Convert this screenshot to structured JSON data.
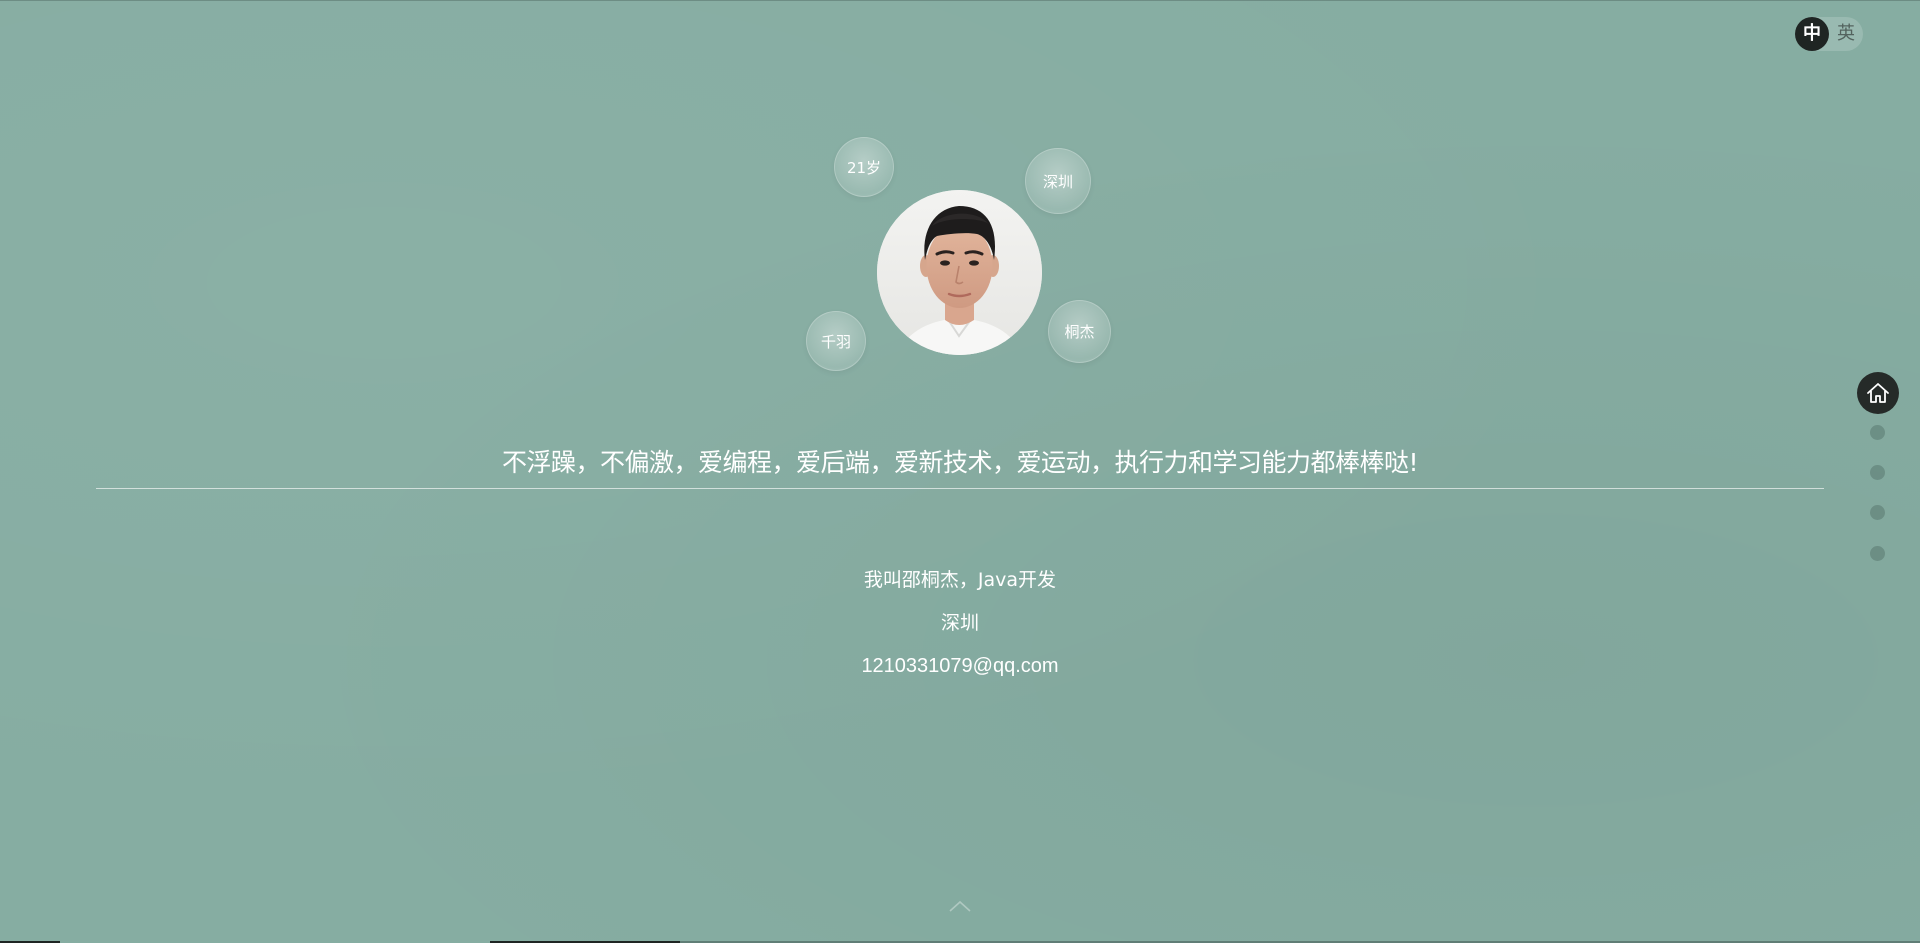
{
  "language_switch": {
    "zh_label": "中",
    "en_label": "英",
    "active": "zh"
  },
  "profile": {
    "avatar_alt": "profile photo",
    "bubbles": {
      "age": "21岁",
      "city": "深圳",
      "alias": "千羽",
      "name": "桐杰"
    }
  },
  "motto": "不浮躁，不偏激，爱编程，爱后端，爱新技术，爱运动，执行力和学习能力都棒棒哒!",
  "info": {
    "intro": "我叫邵桐杰，Java开发",
    "location": "深圳",
    "email": "1210331079@qq.com"
  },
  "side_nav": {
    "icon": "home-icon",
    "dot_count": 4,
    "active_index": 0
  },
  "colors": {
    "background": "#86ada2",
    "dark": "#1f2523",
    "text": "#ffffff"
  }
}
